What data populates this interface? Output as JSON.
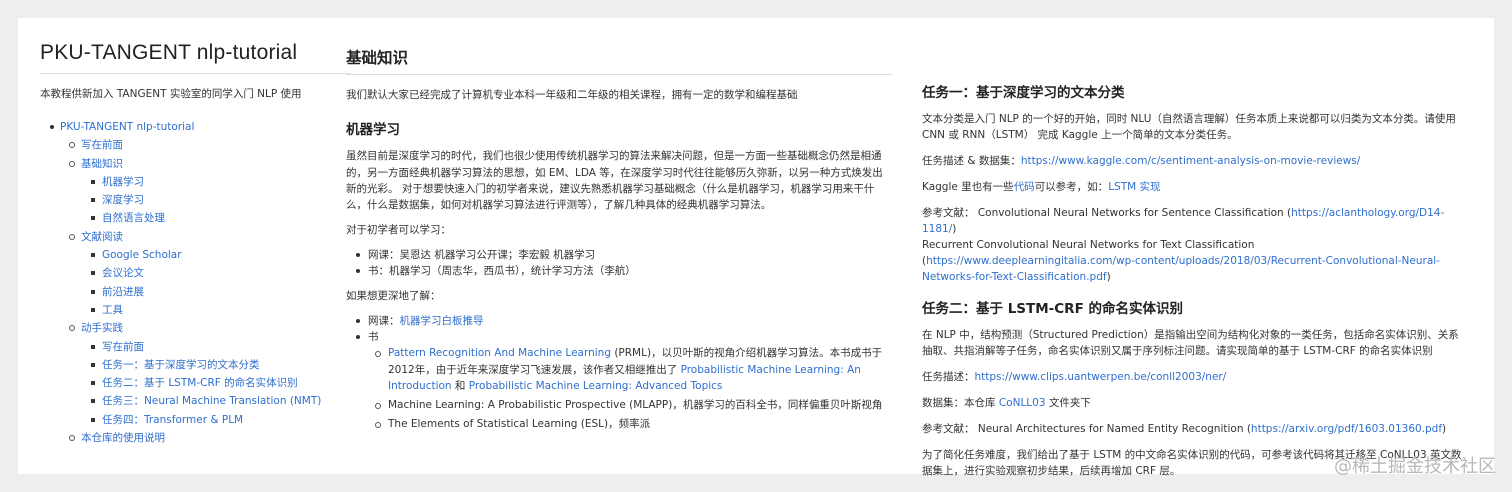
{
  "sidebar": {
    "title": "PKU-TANGENT nlp-tutorial",
    "description": "本教程供新加入 TANGENT 实验室的同学入门 NLP 使用",
    "toc": {
      "root": "PKU-TANGENT nlp-tutorial",
      "items": [
        {
          "label": "写在前面",
          "children": []
        },
        {
          "label": "基础知识",
          "children": [
            "机器学习",
            "深度学习",
            "自然语言处理"
          ]
        },
        {
          "label": "文献阅读",
          "children": [
            "Google Scholar",
            "会议论文",
            "前沿进展",
            "工具"
          ]
        },
        {
          "label": "动手实践",
          "children": [
            "写在前面",
            "任务一：基于深度学习的文本分类",
            "任务二：基于 LSTM-CRF 的命名实体识别",
            "任务三：Neural Machine Translation (NMT)",
            "任务四：Transformer & PLM"
          ]
        },
        {
          "label": "本仓库的使用说明",
          "children": []
        }
      ]
    }
  },
  "middle": {
    "heading": "基础知识",
    "intro": "我们默认大家已经完成了计算机专业本科一年级和二年级的相关课程，拥有一定的数学和编程基础",
    "ml_heading": "机器学习",
    "ml_paragraph": "虽然目前是深度学习的时代，我们也很少使用传统机器学习的算法来解决问题，但是一方面一些基础概念仍然是相通的，另一方面经典机器学习算法的思想，如 EM、LDA 等，在深度学习时代往往能够历久弥新，以另一种方式焕发出新的光彩。 对于想要快速入门的初学者来说，建议先熟悉机器学习基础概念（什么是机器学习，机器学习用来干什么，什么是数据集，如何对机器学习算法进行评测等），了解几种具体的经典机器学习算法。",
    "beginner_label": "对于初学者可以学习：",
    "beginner_items": [
      "网课：吴恩达 机器学习公开课；李宏毅 机器学习",
      "书：机器学习（周志华，西瓜书），统计学习方法（李航）"
    ],
    "deeper_label": "如果想更深地了解：",
    "deeper_course_prefix": "网课：",
    "deeper_course_link": "机器学习白板推导",
    "book_label": "书",
    "book1_link1": "Pattern Recognition And Machine Learning",
    "book1_text1": " (PRML)，以贝叶斯的视角介绍机器学习算法。本书成书于2012年，由于近年来深度学习飞速发展，该作者又相继推出了 ",
    "book1_link2": "Probabilistic Machine Learning: An Introduction",
    "book1_text2": " 和 ",
    "book1_link3": "Probabilistic Machine Learning: Advanced Topics",
    "book2": "Machine Learning: A Probabilistic Prospective (MLAPP)，机器学习的百科全书，同样偏重贝叶斯视角",
    "book3": "The Elements of Statistical Learning (ESL)，频率派"
  },
  "right": {
    "task1_heading": "任务一：基于深度学习的文本分类",
    "task1_p1": "文本分类是入门 NLP 的一个好的开始，同时 NLU（自然语言理解）任务本质上来说都可以归类为文本分类。请使用 CNN 或 RNN（LSTM） 完成 Kaggle 上一个简单的文本分类任务。",
    "task1_desc_label": "任务描述 & 数据集：",
    "task1_desc_link": "https://www.kaggle.com/c/sentiment-analysis-on-movie-reviews/",
    "task1_kaggle_prefix": "Kaggle 里也有一些",
    "task1_kaggle_link1": "代码",
    "task1_kaggle_mid": "可以参考，如：",
    "task1_kaggle_link2": "LSTM 实现",
    "task1_ref_label": "参考文献： Convolutional Neural Networks for Sentence Classification (",
    "task1_ref_link1": "https://aclanthology.org/D14-1181/",
    "task1_ref_mid": ")\nRecurrent Convolutional Neural Networks for Text Classification (",
    "task1_ref_link2": "https://www.deeplearningitalia.com/wp-content/uploads/2018/03/Recurrent-Convolutional-Neural-Networks-for-Text-Classification.pdf",
    "task1_ref_end": ")",
    "task2_heading": "任务二：基于 LSTM-CRF 的命名实体识别",
    "task2_p1": "在 NLP 中，结构预测（Structured Prediction）是指输出空间为结构化对象的一类任务，包括命名实体识别、关系抽取、共指消解等子任务，命名实体识别又属于序列标注问题。请实现简单的基于 LSTM-CRF 的命名实体识别",
    "task2_desc_label": "任务描述：",
    "task2_desc_link": "https://www.clips.uantwerpen.be/conll2003/ner/",
    "task2_data_prefix": "数据集：本仓库 ",
    "task2_data_link": "CoNLL03",
    "task2_data_suffix": " 文件夹下",
    "task2_ref_label": "参考文献： Neural Architectures for Named Entity Recognition (",
    "task2_ref_link": "https://arxiv.org/pdf/1603.01360.pdf",
    "task2_ref_end": ")",
    "task2_p_last": "为了简化任务难度，我们给出了基于 LSTM 的中文命名实体识别的代码，可参考该代码将其迁移至 CoNLL03 英文数据集上，进行实验观察初步结果，后续再增加 CRF 层。"
  },
  "watermark": "@稀土掘金技术社区"
}
